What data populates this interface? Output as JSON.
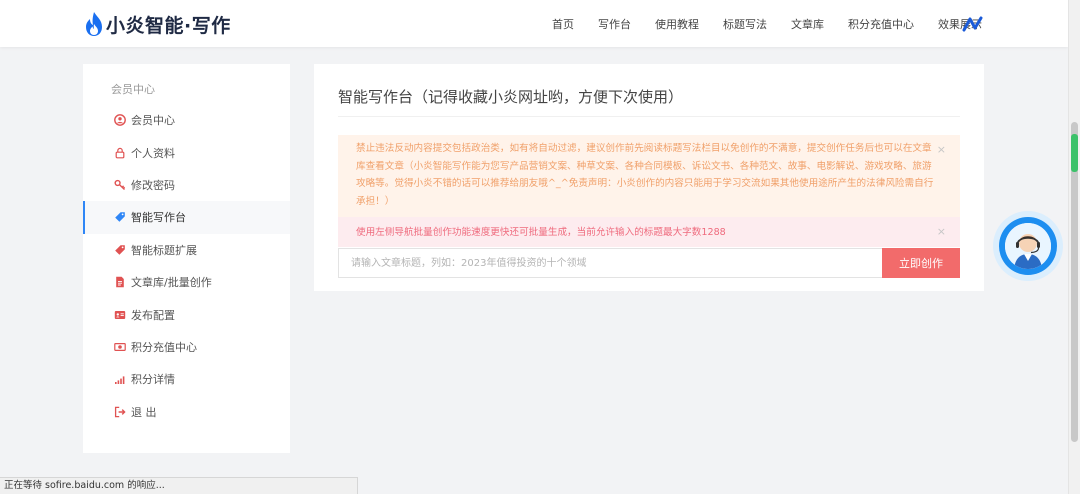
{
  "brand": {
    "name": "小炎智能·写作",
    "logo_icon": "flame-icon",
    "accent": "#1a6ff0"
  },
  "nav": {
    "items": [
      "首页",
      "写作台",
      "使用教程",
      "标题写法",
      "文章库",
      "积分充值中心",
      "效果展示"
    ],
    "trailing_icon": "zigzag-logo-icon"
  },
  "sidebar": {
    "heading": "会员中心",
    "items": [
      {
        "label": "会员中心",
        "icon": "user-circle-icon",
        "active": false
      },
      {
        "label": "个人资料",
        "icon": "lock-icon",
        "active": false
      },
      {
        "label": "修改密码",
        "icon": "key-icon",
        "active": false
      },
      {
        "label": "智能写作台",
        "icon": "tag-icon",
        "active": true
      },
      {
        "label": "智能标题扩展",
        "icon": "tag-icon",
        "active": false
      },
      {
        "label": "文章库/批量创作",
        "icon": "document-icon",
        "active": false
      },
      {
        "label": "发布配置",
        "icon": "id-card-icon",
        "active": false
      },
      {
        "label": "积分充值中心",
        "icon": "money-icon",
        "active": false
      },
      {
        "label": "积分详情",
        "icon": "signal-bars-icon",
        "active": false
      },
      {
        "label": "退 出",
        "icon": "sign-out-icon",
        "active": false
      }
    ]
  },
  "main": {
    "title": "智能写作台（记得收藏小炎网址哟，方便下次使用）",
    "notice_warning": "禁止违法反动内容提交包括政治类，如有将自动过滤，建议创作前先阅读标题写法栏目以免创作的不满意，提交创作任务后也可以在文章库查看文章（小炎智能写作能为您写产品营销文案、种草文案、各种合同模板、诉讼文书、各种范文、故事、电影解说、游戏攻略、旅游攻略等。觉得小炎不错的话可以推荐给朋友哦^_^免责声明：小炎创作的内容只能用于学习交流如果其他使用途所产生的法律风险需自行承担！）",
    "notice_danger": "使用左侧导航批量创作功能速度更快还可批量生成，当前允许输入的标题最大字数1288",
    "close_symbol": "×",
    "input_placeholder": "请输入文章标题，列如：2023年值得投资的十个领域",
    "input_value": "",
    "submit_label": "立即创作"
  },
  "support_widget": {
    "icon": "customer-service-avatar-icon"
  },
  "status_bar": {
    "text": "正在等待 sofire.baidu.com 的响应..."
  },
  "colors": {
    "warning_bg": "#fff3ea",
    "warning_text": "#f0a06a",
    "danger_bg": "#fdecef",
    "danger_text": "#ef6b7e",
    "button": "#f26b6b",
    "active_marker": "#2f86f6"
  }
}
